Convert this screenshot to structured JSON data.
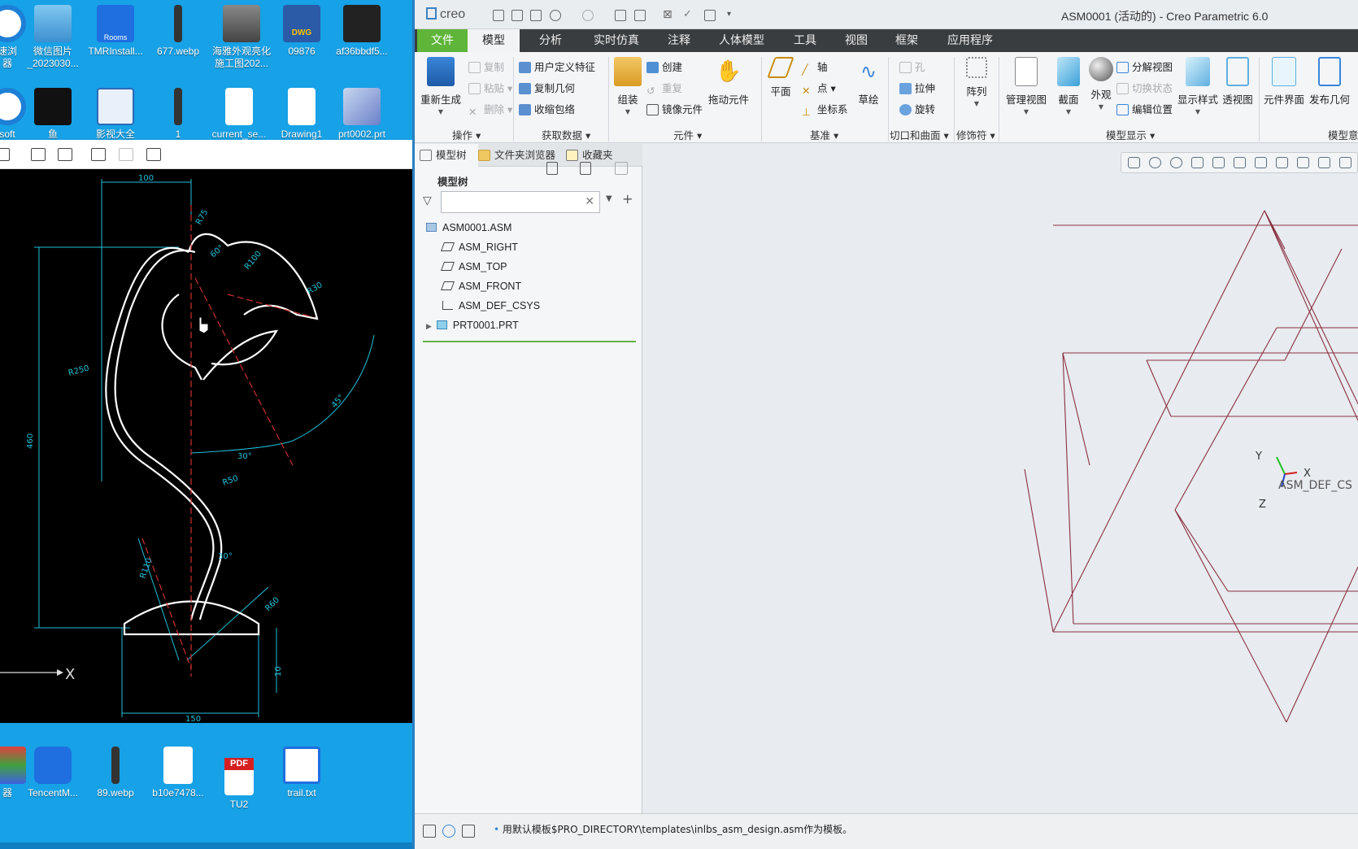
{
  "desktop": {
    "icons_row1": [
      "速浏\n器",
      "微信图片\n_2023030...",
      "TMRInstall...",
      "677.webp",
      "海雅外观亮化\n施工图202...",
      "09876",
      "af36bbdf5..."
    ],
    "icons_row2": [
      "soft",
      "鱼",
      "影视大全",
      "1",
      "current_se...",
      "Drawing1",
      "prt0002.prt"
    ],
    "icons_row3": [
      "器",
      "TencentM...",
      "89.webp",
      "b10e7478...",
      "TU2",
      "trail.txt"
    ],
    "dwg_badge": "DWG",
    "pdf_badge": "PDF",
    "rooms_badge": "Rooms"
  },
  "drawing": {
    "dim_top": "100",
    "dim_left": "460",
    "dim_bottom": "150",
    "dim_small": "10",
    "r_labels": [
      "R75",
      "R30",
      "R100",
      "R50",
      "R250",
      "R40",
      "R110",
      "R200",
      "R60",
      "R20"
    ],
    "angle_labels": [
      "60°",
      "45°",
      "30°",
      "30°"
    ],
    "axis_x": "X"
  },
  "creo": {
    "logo": "creo",
    "title": "ASM0001 (活动的) - Creo Parametric 6.0",
    "menu_tabs": [
      "文件",
      "模型",
      "分析",
      "实时仿真",
      "注释",
      "人体模型",
      "工具",
      "视图",
      "框架",
      "应用程序"
    ],
    "ribbon": {
      "regen": "重新生成",
      "copy": "复制",
      "paste": "粘贴",
      "delete": "删除",
      "group_ops": "操作",
      "user_feature": "用户定义特征",
      "copy_geom": "复制几何",
      "shrinkwrap": "收缩包络",
      "group_data": "获取数据",
      "assemble": "组装",
      "create": "创建",
      "repeat": "重复",
      "mirror_comp": "镜像元件",
      "drag_comp": "拖动元件",
      "group_comp": "元件",
      "plane": "平面",
      "axis": "轴",
      "point": "点",
      "csys": "坐标系",
      "sketch": "草绘",
      "group_datum": "基准",
      "hole": "孔",
      "extrude": "拉伸",
      "revolve": "旋转",
      "group_cut": "切口和曲面",
      "pattern": "阵列",
      "group_mod": "修饰符",
      "manage_views": "管理视图",
      "section": "截面",
      "appearance": "外观",
      "explode_view": "分解视图",
      "toggle_state": "切换状态",
      "edit_pos": "编辑位置",
      "display_style": "显示样式",
      "perspective": "透视图",
      "group_display": "模型显示",
      "comp_interface": "元件界面",
      "publish_geom": "发布几何",
      "group_intent": "模型意"
    },
    "panel": {
      "tabs": [
        "模型树",
        "文件夹浏览器",
        "收藏夹"
      ],
      "tree_header": "模型树",
      "filter_placeholder": "",
      "nodes": [
        "ASM0001.ASM",
        "ASM_RIGHT",
        "ASM_TOP",
        "ASM_FRONT",
        "ASM_DEF_CSYS",
        "PRT0001.PRT"
      ]
    },
    "graphics": {
      "csys_label": "ASM_DEF_CS",
      "axis_x": "X",
      "axis_y": "Y",
      "axis_z": "Z"
    },
    "status": "用默认模板$PRO_DIRECTORY\\templates\\inlbs_asm_design.asm作为模板。"
  }
}
